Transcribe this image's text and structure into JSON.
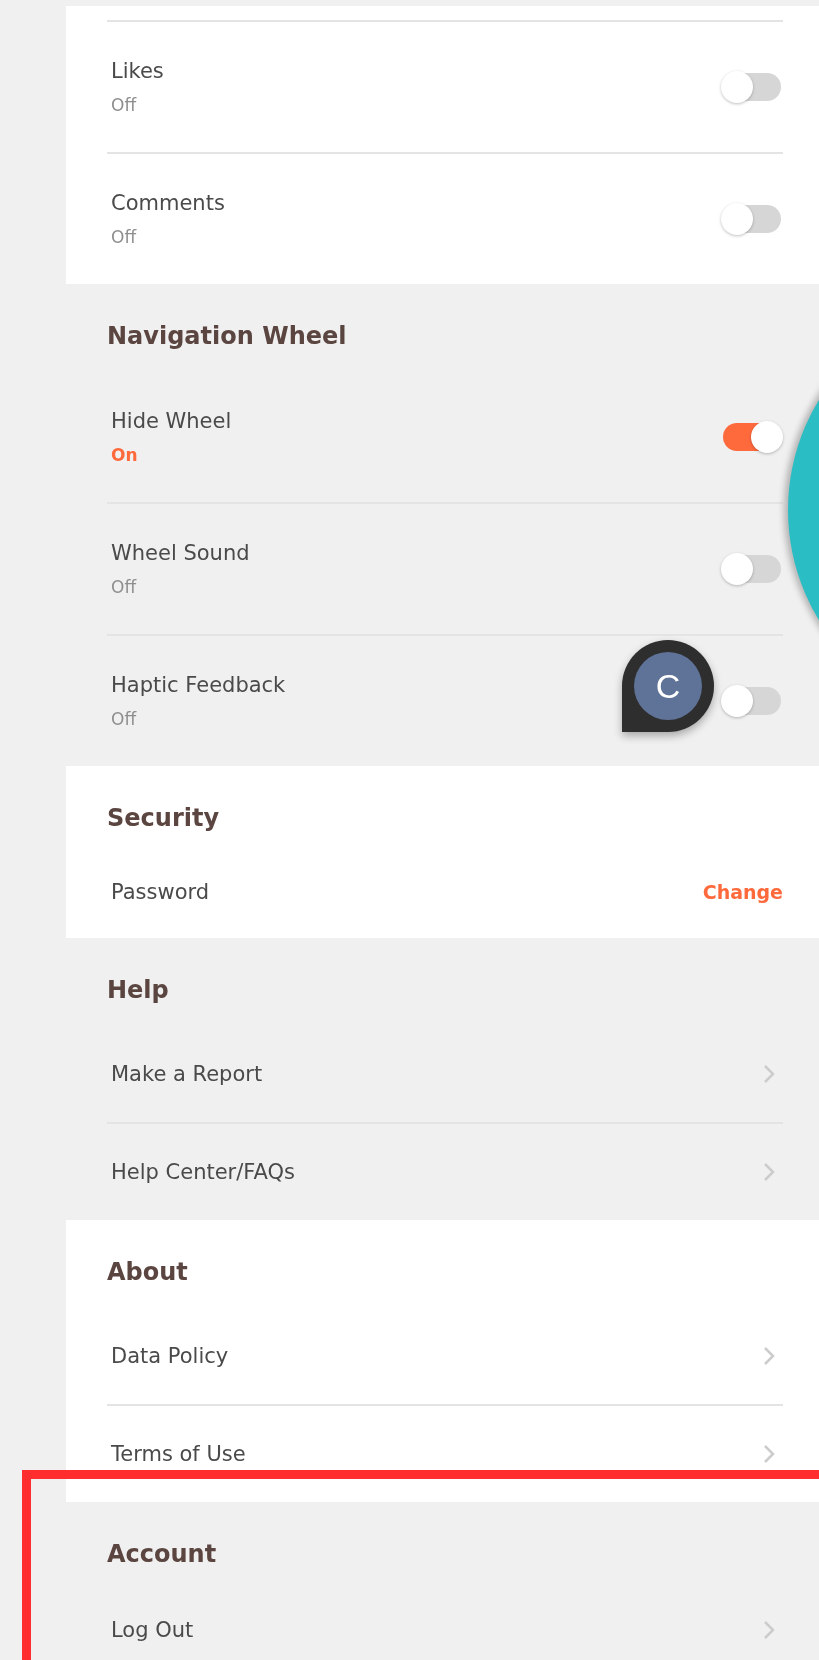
{
  "sections": [
    {
      "shaded": false,
      "highlighted": false,
      "rows": [
        {
          "kind": "toggle",
          "label": "Likes",
          "status": "Off",
          "on": false
        },
        {
          "kind": "toggle",
          "label": "Comments",
          "status": "Off",
          "on": false
        }
      ]
    },
    {
      "shaded": true,
      "highlighted": false,
      "heading": "Navigation Wheel",
      "rows": [
        {
          "kind": "toggle",
          "label": "Hide Wheel",
          "status": "On",
          "on": true
        },
        {
          "kind": "toggle",
          "label": "Wheel Sound",
          "status": "Off",
          "on": false
        },
        {
          "kind": "toggle",
          "label": "Haptic Feedback",
          "status": "Off",
          "on": false
        }
      ]
    },
    {
      "shaded": false,
      "highlighted": false,
      "heading": "Security",
      "rows": [
        {
          "kind": "action",
          "label": "Password",
          "action": "Change"
        }
      ]
    },
    {
      "shaded": true,
      "highlighted": false,
      "heading": "Help",
      "rows": [
        {
          "kind": "link",
          "label": "Make a Report"
        },
        {
          "kind": "link",
          "label": "Help Center/FAQs"
        }
      ]
    },
    {
      "shaded": false,
      "highlighted": false,
      "heading": "About",
      "rows": [
        {
          "kind": "link",
          "label": "Data Policy"
        },
        {
          "kind": "link",
          "label": "Terms of Use"
        }
      ]
    },
    {
      "shaded": true,
      "highlighted": true,
      "heading": "Account",
      "rows": [
        {
          "kind": "link",
          "label": "Log Out"
        }
      ]
    }
  ],
  "chat_bubble": {
    "letter": "C"
  }
}
